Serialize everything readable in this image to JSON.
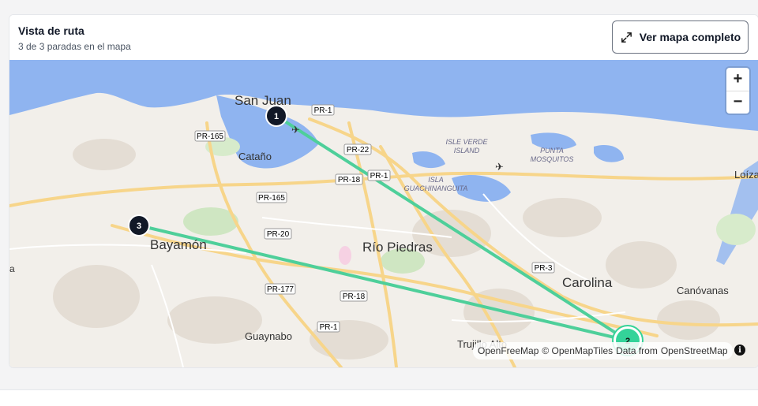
{
  "header": {
    "title": "Vista de ruta",
    "subtitle": "3 de 3 paradas en el mapa",
    "full_map_button": "Ver mapa completo"
  },
  "zoom": {
    "in": "+",
    "out": "−"
  },
  "attribution": {
    "provider": "OpenFreeMap",
    "tiles": "© OpenMapTiles",
    "data_prefix": "Data from",
    "data_source": "OpenStreetMap"
  },
  "stops": [
    {
      "number": "1",
      "color": "#111827"
    },
    {
      "number": "2",
      "color": "#34d399"
    },
    {
      "number": "3",
      "color": "#111827"
    }
  ],
  "place_labels": {
    "san_juan": "San Juan",
    "catano": "Cataño",
    "bayamon": "Bayamón",
    "rio_piedras": "Río Piedras",
    "carolina": "Carolina",
    "canovanas": "Canóvanas",
    "guaynabo": "Guaynabo",
    "trujillo_alto": "Trujillo Alto",
    "loiza": "Loíza",
    "isle_verde_1": "ISLE VERDE",
    "isle_verde_2": "ISLAND",
    "isla_1": "ISLA",
    "isla_2": "GUACHINANGUITA",
    "punta_1": "PUNTA",
    "punta_2": "MOSQUITOS",
    "a": "a"
  },
  "road_shields": {
    "pr1_a": "PR-1",
    "pr165_a": "PR-165",
    "pr22": "PR-22",
    "pr18_a": "PR-18",
    "pr1_b": "PR-1",
    "pr165_b": "PR-165",
    "pr20": "PR-20",
    "pr3": "PR-3",
    "pr177": "PR-177",
    "pr18_b": "PR-18",
    "pr1_c": "PR-1"
  },
  "colors": {
    "water": "#8fb4f0",
    "land": "#f2efea",
    "route": "#4ecf9a"
  }
}
